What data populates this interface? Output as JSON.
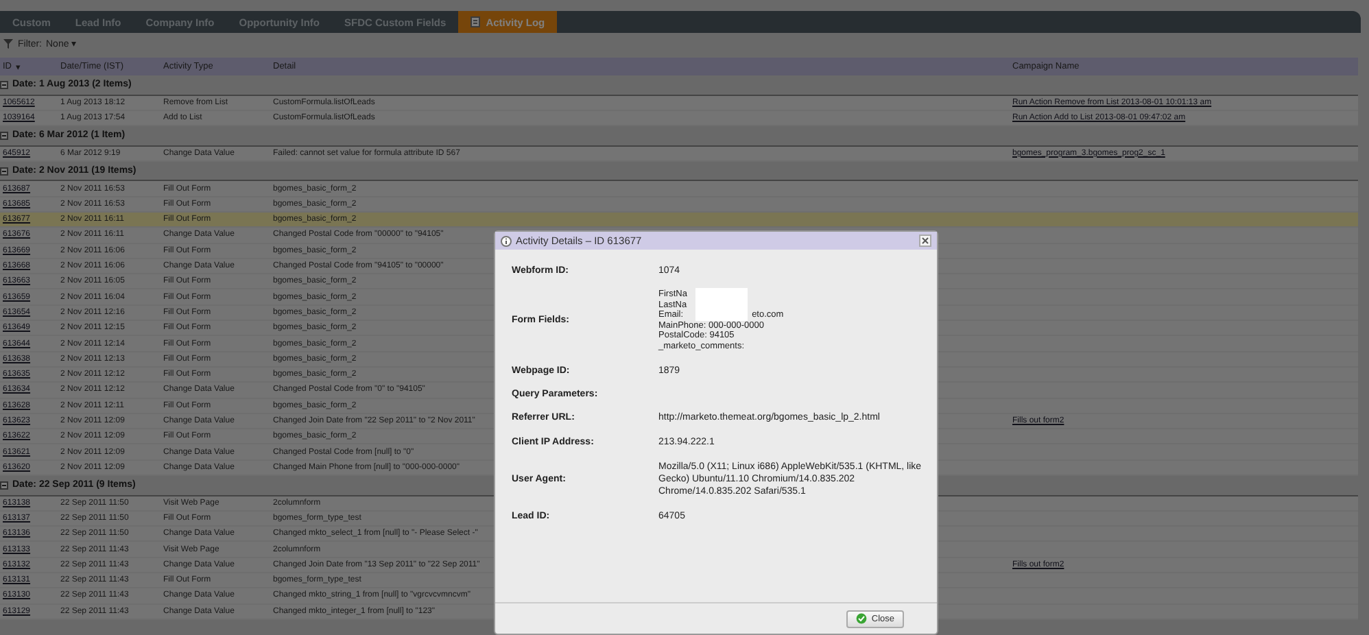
{
  "tabs": [
    {
      "label": "Custom",
      "selected": false,
      "icon": false
    },
    {
      "label": "Lead Info",
      "selected": false,
      "icon": false
    },
    {
      "label": "Company Info",
      "selected": false,
      "icon": false
    },
    {
      "label": "Opportunity Info",
      "selected": false,
      "icon": false
    },
    {
      "label": "SFDC Custom Fields",
      "selected": false,
      "icon": false
    },
    {
      "label": "Activity Log",
      "selected": true,
      "icon": true
    }
  ],
  "filter": {
    "label": "Filter:",
    "value": "None",
    "caret": "▾"
  },
  "table": {
    "columns": [
      {
        "label": "ID",
        "sort_mark": "▾"
      },
      {
        "label": "Date/Time (IST)"
      },
      {
        "label": "Activity Type"
      },
      {
        "label": "Detail"
      },
      {
        "label": "Campaign Name"
      }
    ],
    "groups": [
      {
        "label": "Date: 1 Aug 2013 (2 Items)",
        "expanded": true,
        "rows": [
          {
            "id": "1065612",
            "datetime": "1 Aug 2013 18:12",
            "activity_type": "Remove from List",
            "detail": "CustomFormula.listOfLeads",
            "campaign_name": "Run Action Remove from List 2013-08-01 10:01:13 am",
            "selected": false
          },
          {
            "id": "1039164",
            "datetime": "1 Aug 2013 17:54",
            "activity_type": "Add to List",
            "detail": "CustomFormula.listOfLeads",
            "campaign_name": "Run Action Add to List 2013-08-01 09:47:02 am",
            "selected": false
          }
        ]
      },
      {
        "label": "Date: 6 Mar 2012 (1 Item)",
        "expanded": true,
        "rows": [
          {
            "id": "645912",
            "datetime": "6 Mar 2012 9:19",
            "activity_type": "Change Data Value",
            "detail": "Failed: cannot set value for formula attribute ID 567",
            "campaign_name": "bgomes_program_3.bgomes_prog2_sc_1",
            "selected": false
          }
        ]
      },
      {
        "label": "Date: 2 Nov 2011 (19 Items)",
        "expanded": true,
        "rows": [
          {
            "id": "613687",
            "datetime": "2 Nov 2011 16:53",
            "activity_type": "Fill Out Form",
            "detail": "bgomes_basic_form_2",
            "selected": false
          },
          {
            "id": "613685",
            "datetime": "2 Nov 2011 16:53",
            "activity_type": "Fill Out Form",
            "detail": "bgomes_basic_form_2",
            "selected": false
          },
          {
            "id": "613677",
            "datetime": "2 Nov 2011 16:11",
            "activity_type": "Fill Out Form",
            "detail": "bgomes_basic_form_2",
            "selected": true
          },
          {
            "id": "613676",
            "datetime": "2 Nov 2011 16:11",
            "activity_type": "Change Data Value",
            "detail": "Changed Postal Code from \"00000\" to \"94105\"",
            "selected": false
          },
          {
            "id": "613669",
            "datetime": "2 Nov 2011 16:06",
            "activity_type": "Fill Out Form",
            "detail": "bgomes_basic_form_2",
            "selected": false
          },
          {
            "id": "613668",
            "datetime": "2 Nov 2011 16:06",
            "activity_type": "Change Data Value",
            "detail": "Changed Postal Code from \"94105\" to \"00000\"",
            "selected": false
          },
          {
            "id": "613663",
            "datetime": "2 Nov 2011 16:05",
            "activity_type": "Fill Out Form",
            "detail": "bgomes_basic_form_2",
            "selected": false
          },
          {
            "id": "613659",
            "datetime": "2 Nov 2011 16:04",
            "activity_type": "Fill Out Form",
            "detail": "bgomes_basic_form_2",
            "selected": false
          },
          {
            "id": "613654",
            "datetime": "2 Nov 2011 12:16",
            "activity_type": "Fill Out Form",
            "detail": "bgomes_basic_form_2",
            "selected": false
          },
          {
            "id": "613649",
            "datetime": "2 Nov 2011 12:15",
            "activity_type": "Fill Out Form",
            "detail": "bgomes_basic_form_2",
            "selected": false
          },
          {
            "id": "613644",
            "datetime": "2 Nov 2011 12:14",
            "activity_type": "Fill Out Form",
            "detail": "bgomes_basic_form_2",
            "selected": false
          },
          {
            "id": "613638",
            "datetime": "2 Nov 2011 12:13",
            "activity_type": "Fill Out Form",
            "detail": "bgomes_basic_form_2",
            "selected": false
          },
          {
            "id": "613635",
            "datetime": "2 Nov 2011 12:12",
            "activity_type": "Fill Out Form",
            "detail": "bgomes_basic_form_2",
            "selected": false
          },
          {
            "id": "613634",
            "datetime": "2 Nov 2011 12:12",
            "activity_type": "Change Data Value",
            "detail": "Changed Postal Code from \"0\" to \"94105\"",
            "selected": false
          },
          {
            "id": "613628",
            "datetime": "2 Nov 2011 12:11",
            "activity_type": "Fill Out Form",
            "detail": "bgomes_basic_form_2",
            "selected": false
          },
          {
            "id": "613623",
            "datetime": "2 Nov 2011 12:09",
            "activity_type": "Change Data Value",
            "detail": "Changed Join Date from \"22 Sep 2011\" to \"2 Nov 2011\"",
            "campaign_name": "Fills out form2",
            "selected": false
          },
          {
            "id": "613622",
            "datetime": "2 Nov 2011 12:09",
            "activity_type": "Fill Out Form",
            "detail": "bgomes_basic_form_2",
            "selected": false
          },
          {
            "id": "613621",
            "datetime": "2 Nov 2011 12:09",
            "activity_type": "Change Data Value",
            "detail": "Changed Postal Code from [null] to \"0\"",
            "selected": false
          },
          {
            "id": "613620",
            "datetime": "2 Nov 2011 12:09",
            "activity_type": "Change Data Value",
            "detail": "Changed Main Phone from [null] to \"000-000-0000\"",
            "selected": false
          }
        ]
      },
      {
        "label": "Date: 22 Sep 2011 (9 Items)",
        "expanded": true,
        "rows": [
          {
            "id": "613138",
            "datetime": "22 Sep 2011 11:50",
            "activity_type": "Visit Web Page",
            "detail": "2columnform",
            "selected": false
          },
          {
            "id": "613137",
            "datetime": "22 Sep 2011 11:50",
            "activity_type": "Fill Out Form",
            "detail": "bgomes_form_type_test",
            "selected": false
          },
          {
            "id": "613136",
            "datetime": "22 Sep 2011 11:50",
            "activity_type": "Change Data Value",
            "detail": "Changed mkto_select_1 from [null] to \"- Please Select -\"",
            "selected": false
          },
          {
            "id": "613133",
            "datetime": "22 Sep 2011 11:43",
            "activity_type": "Visit Web Page",
            "detail": "2columnform",
            "selected": false
          },
          {
            "id": "613132",
            "datetime": "22 Sep 2011 11:43",
            "activity_type": "Change Data Value",
            "detail": "Changed Join Date from \"13 Sep 2011\" to \"22 Sep 2011\"",
            "campaign_name": "Fills out form2",
            "selected": false
          },
          {
            "id": "613131",
            "datetime": "22 Sep 2011 11:43",
            "activity_type": "Fill Out Form",
            "detail": "bgomes_form_type_test",
            "selected": false
          },
          {
            "id": "613130",
            "datetime": "22 Sep 2011 11:43",
            "activity_type": "Change Data Value",
            "detail": "Changed mkto_string_1 from [null] to \"vgrcvcvmncvm\"",
            "selected": false
          },
          {
            "id": "613129",
            "datetime": "22 Sep 2011 11:43",
            "activity_type": "Change Data Value",
            "detail": "Changed mkto_integer_1 from [null] to \"123\"",
            "selected": false
          }
        ]
      }
    ]
  },
  "dialog": {
    "title": "Activity Details – ID 613677",
    "fields": [
      {
        "kind": "text",
        "label": "Webform ID:",
        "value": "1074"
      },
      {
        "kind": "form",
        "label": "Form Fields:",
        "redacted": true,
        "lines": [
          {
            "text": "FirstNa"
          },
          {
            "text": "LastNa"
          },
          {
            "text": "Email:",
            "tail": "eto.com"
          },
          {
            "text": "MainPhone: 000-000-0000"
          },
          {
            "text": "PostalCode: 94105"
          },
          {
            "text": "_marketo_comments:"
          }
        ]
      },
      {
        "kind": "text",
        "label": "Webpage ID:",
        "value": "1879"
      },
      {
        "kind": "text",
        "label": "Query Parameters:"
      },
      {
        "kind": "text",
        "label": "Referrer URL:",
        "value": "http://marketo.themeat.org/bgomes_basic_lp_2.html"
      },
      {
        "kind": "text",
        "label": "Client IP Address:",
        "value": "213.94.222.1"
      },
      {
        "kind": "text",
        "label": "User Agent:",
        "value": "Mozilla/5.0 (X11; Linux i686) AppleWebKit/535.1 (KHTML, like Gecko) Ubuntu/11.10 Chromium/14.0.835.202 Chrome/14.0.835.202 Safari/535.1"
      },
      {
        "kind": "text",
        "label": "Lead ID:",
        "value": "64705"
      }
    ],
    "close_button": "Close"
  }
}
